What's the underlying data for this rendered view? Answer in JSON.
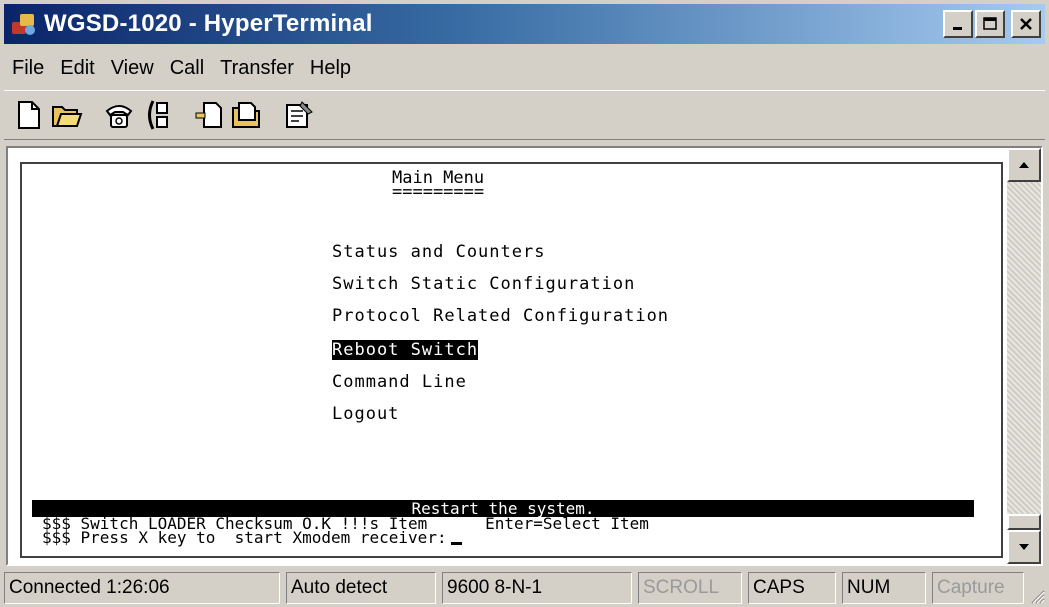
{
  "window": {
    "title": "WGSD-1020 - HyperTerminal",
    "title_buttons": [
      "_",
      "□",
      "×"
    ]
  },
  "menubar": {
    "items": [
      "File",
      "Edit",
      "View",
      "Call",
      "Transfer",
      "Help"
    ]
  },
  "toolbar": {
    "tools": [
      "new-document-icon",
      "open-folder-icon",
      "connect-phone-icon",
      "disconnect-phone-icon",
      "send-icon",
      "receive-icon",
      "properties-icon"
    ]
  },
  "terminal": {
    "title": "Main Menu",
    "underline": "=========",
    "options": [
      "Status and Counters",
      "Switch Static Configuration",
      "Protocol Related Configuration",
      "Reboot Switch",
      "Command Line",
      "Logout"
    ],
    "selected_option": "Reboot Switch",
    "status_line": "Restart the system.",
    "line1": "$$$ Switch LOADER Checksum O.K !!!s Item      Enter=Select Item",
    "line2": "$$$ Press X key to  start Xmodem receiver:"
  },
  "statusbar": {
    "connected": "Connected 1:26:06",
    "detect": "Auto detect",
    "settings": "9600 8-N-1",
    "scroll": "SCROLL",
    "caps": "CAPS",
    "num": "NUM",
    "capture": "Capture"
  },
  "colors": {
    "title_start": "#0a246a",
    "title_end": "#a6caf0",
    "chrome": "#d4d0c8"
  }
}
